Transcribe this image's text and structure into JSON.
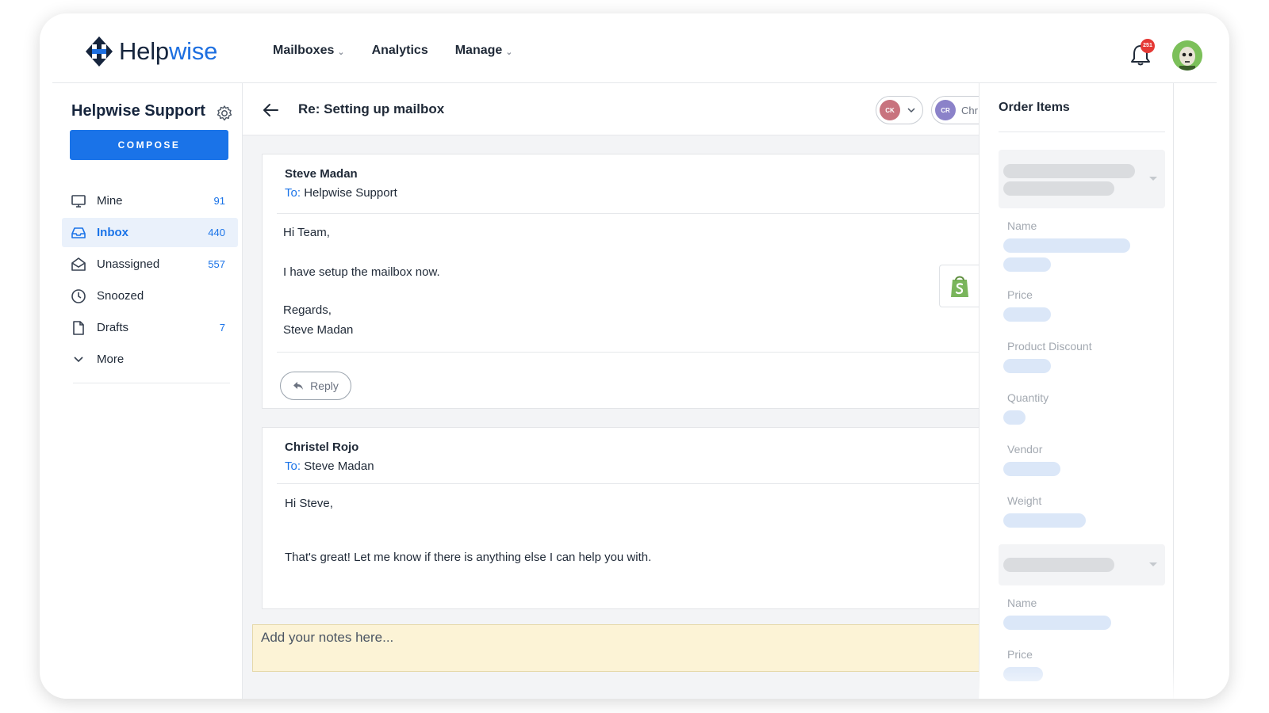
{
  "app": {
    "logo_text_dark": "Help",
    "logo_text_accent": "wise",
    "brand_color": "#1a73e8"
  },
  "nav": {
    "items": [
      {
        "label": "Mailboxes",
        "has_dropdown": true
      },
      {
        "label": "Analytics",
        "has_dropdown": false
      },
      {
        "label": "Manage",
        "has_dropdown": true
      }
    ],
    "notification_count": "251"
  },
  "sidebar": {
    "mailbox_title": "Helpwise Support",
    "compose_label": "COMPOSE",
    "items": [
      {
        "label": "Mine",
        "count": "91",
        "icon": "monitor-icon",
        "active": false
      },
      {
        "label": "Inbox",
        "count": "440",
        "icon": "inbox-icon",
        "active": true
      },
      {
        "label": "Unassigned",
        "count": "557",
        "icon": "envelope-open-icon",
        "active": false
      },
      {
        "label": "Snoozed",
        "count": "",
        "icon": "clock-icon",
        "active": false
      },
      {
        "label": "Drafts",
        "count": "7",
        "icon": "file-icon",
        "active": false
      },
      {
        "label": "More",
        "count": "",
        "icon": "chevron-down-icon",
        "active": false
      }
    ]
  },
  "conversation": {
    "subject": "Re: Setting up mailbox",
    "assignees": [
      {
        "initials": "CK",
        "color": "#c8737e",
        "name": ""
      },
      {
        "initials": "CR",
        "color": "#8b82c9",
        "name": "Chr"
      }
    ],
    "messages": [
      {
        "from": "Steve Madan",
        "to_label": "To:",
        "to": "Helpwise Support",
        "lines": [
          "Hi Team,",
          "I have setup the mailbox now.",
          "Regards,",
          "Steve Madan"
        ],
        "reply_label": "Reply"
      },
      {
        "from": "Christel Rojo",
        "to_label": "To:",
        "to": "Steve Madan",
        "lines": [
          "Hi Steve,",
          "That's great! Let me know if there is anything else I can help you with."
        ]
      }
    ],
    "notes_placeholder": "Add your notes here..."
  },
  "order_panel": {
    "title": "Order Items",
    "groups": [
      {
        "fields": [
          "Name",
          "Price",
          "Product Discount",
          "Quantity",
          "Vendor",
          "Weight"
        ]
      },
      {
        "fields": [
          "Name",
          "Price"
        ]
      }
    ]
  }
}
